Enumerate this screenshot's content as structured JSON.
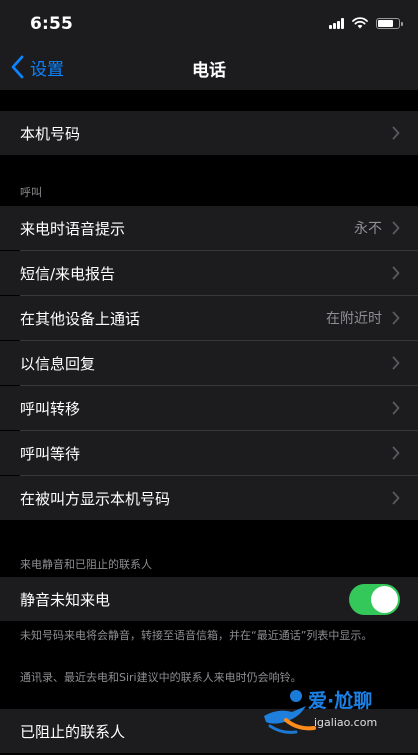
{
  "status_bar": {
    "time": "6:55"
  },
  "nav": {
    "back_label": "设置",
    "title": "电话"
  },
  "rows": {
    "my_number": {
      "label": "本机号码"
    },
    "announce_calls": {
      "label": "来电时语音提示",
      "value": "永不"
    },
    "sms_call_reporting": {
      "label": "短信/来电报告"
    },
    "calls_other_devices": {
      "label": "在其他设备上通话",
      "value": "在附近时"
    },
    "respond_with_text": {
      "label": "以信息回复"
    },
    "call_forwarding": {
      "label": "呼叫转移"
    },
    "call_waiting": {
      "label": "呼叫等待"
    },
    "show_caller_id": {
      "label": "在被叫方显示本机号码"
    },
    "silence_unknown": {
      "label": "静音未知来电",
      "enabled": true
    },
    "blocked_contacts": {
      "label": "已阻止的联系人"
    }
  },
  "sections": {
    "calls_header": "呼叫",
    "silence_header": "来电静音和已阻止的联系人",
    "silence_footer_1": "未知号码来电将会静音，转接至语音信箱，并在“最近通话”列表中显示。",
    "silence_footer_2": "通讯录、最近去电和Siri建议中的联系人来电时仍会响铃。"
  },
  "watermark": {
    "brand": "爱·尬聊",
    "url": "igaliao.com"
  },
  "colors": {
    "accent": "#0a84ff",
    "toggle_on": "#34c759",
    "cell_bg": "#1c1c1e",
    "background": "#000000"
  }
}
